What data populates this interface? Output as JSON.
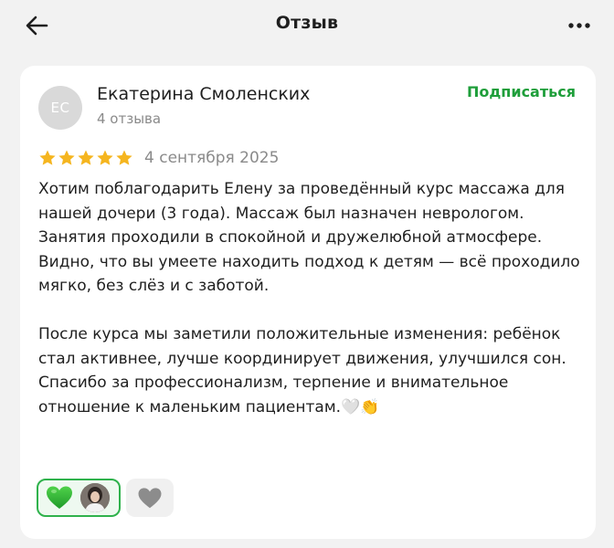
{
  "header": {
    "title": "Отзыв",
    "back_icon": "arrow-left-icon",
    "more_icon": "more-horizontal-icon"
  },
  "review": {
    "author": {
      "initials": "ЕС",
      "name": "Екатерина Смоленских",
      "reviews_count": "4 отзыва"
    },
    "subscribe_label": "Подписаться",
    "rating": 5,
    "rating_max": 5,
    "date": "4 сентября 2025",
    "text": "Хотим поблагодарить Елену за проведённый курс массажа для нашей дочери (3 года). Массаж был назначен неврологом.\nЗанятия проходили в спокойной и дружелюбной атмосфере. Видно, что вы умеете находить подход к детям — всё проходило мягко, без слёз и с заботой.\n\nПосле курса мы заметили положительные изменения: ребёнок стал активнее, лучше координирует движения, улучшился сон.\nСпасибо за профессионализм, терпение и внимательное отношение к маленьким пациентам.🤍👏"
  },
  "reactions": {
    "active": {
      "icon": "green-heart-icon",
      "reactor": "reactor-avatar"
    },
    "inactive": {
      "icon": "grey-heart-icon"
    }
  },
  "colors": {
    "accent_green": "#1e9e3a",
    "star_yellow": "#f5b51f",
    "background": "#f2f2f2",
    "card": "#ffffff"
  }
}
